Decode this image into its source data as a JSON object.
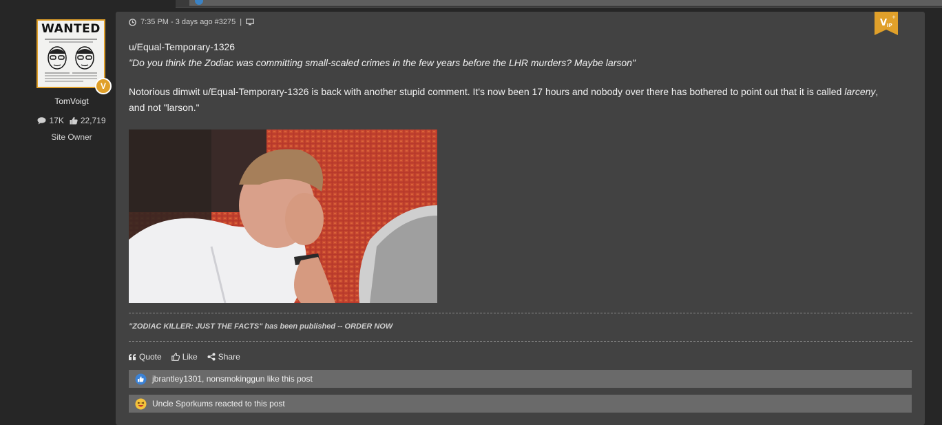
{
  "author": {
    "avatar_text": "WANTED",
    "name": "TomVoigt",
    "posts_count": "17K",
    "likes_count": "22,719",
    "role": "Site Owner",
    "badge": "V"
  },
  "post": {
    "meta_time": "7:35 PM - 3 days ago #3275",
    "quote_user": "u/Equal-Temporary-1326",
    "quote_text": "\"Do you think the Zodiac was committing small-scaled crimes in the few years before the LHR murders? Maybe larson\"",
    "body_before": "Notorious dimwit u/Equal-Temporary-1326 is back with another stupid comment. It's now been 17 hours and nobody over there has bothered to point out that it is called ",
    "body_italic": "larceny",
    "body_after": ",",
    "body_line2": "and not \"larson.\"",
    "signature": "\"ZODIAC KILLER: JUST THE FACTS\" has been published -- ORDER NOW",
    "actions": {
      "quote": "Quote",
      "like": "Like",
      "share": "Share"
    },
    "likes_text": "jbrantley1301, nonsmokinggun like this post",
    "reaction_text": "Uncle Sporkums reacted to this post"
  },
  "colors": {
    "accent": "#e0a02a",
    "panel": "#424242",
    "background": "#262626",
    "bar": "#6a6a6a"
  }
}
